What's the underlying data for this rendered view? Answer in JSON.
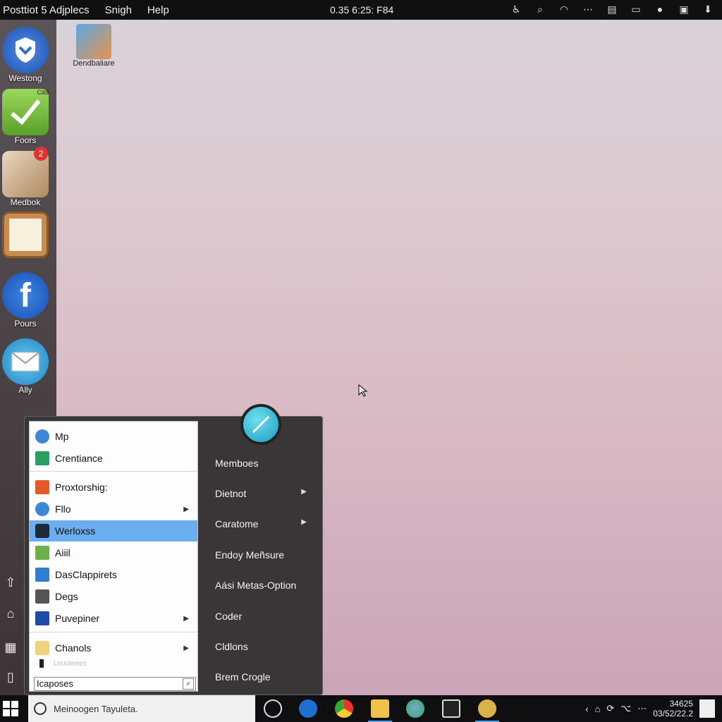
{
  "topbar": {
    "menus": [
      "Posttiot 5 Adjplecs",
      "Snigh",
      "Help"
    ],
    "clock": "0.35 6:25: F84"
  },
  "dock": {
    "apps": [
      {
        "label": "Westong",
        "icon": "shield-icon",
        "color": "#2f6fd0"
      },
      {
        "label": "Foors",
        "icon": "checkmark-icon",
        "color": "#7ac13b",
        "corner": "Cildi"
      },
      {
        "label": "Medbok",
        "icon": "photo-icon",
        "color": "#caa98a",
        "badge": "2"
      },
      {
        "label": "",
        "icon": "notepad-icon",
        "color": "#c9894a"
      },
      {
        "label": "Pours",
        "icon": "facebook-icon",
        "color": "#2a6ed4"
      },
      {
        "label": "Ally",
        "icon": "mail-icon",
        "color": "#3aa7e0"
      }
    ]
  },
  "desktop_icon": {
    "label": "Dendbaliare"
  },
  "start_menu": {
    "left_items": [
      {
        "label": "Mp",
        "color": "#3b87d8"
      },
      {
        "label": "Crentiance",
        "color": "#2aa060"
      },
      {
        "label": "Proxtorshig:",
        "color": "#e35b2b"
      },
      {
        "label": "Fllo",
        "color": "#3a89d2",
        "arrow": true
      },
      {
        "label": "Werloxss",
        "color": "#1e2a3a",
        "selected": true
      },
      {
        "label": "Aiiil",
        "color": "#6bb04a"
      },
      {
        "label": "DasClappirets",
        "color": "#2e7fcf"
      },
      {
        "label": "Degs",
        "color": "#555555"
      },
      {
        "label": "Puvepiner",
        "color": "#1f4aa8",
        "arrow": true
      },
      {
        "label": "Chanols",
        "color": "#f0d37a",
        "arrow": true
      }
    ],
    "faded_item": "Lnuuteees",
    "search_value": "Icaposes",
    "right_items": [
      {
        "label": "Memboes"
      },
      {
        "label": "Dietnot",
        "arrow": true
      },
      {
        "label": "Caratome",
        "arrow": true
      },
      {
        "label": "Endoy Meñsure"
      },
      {
        "label": "Aási Metas-Option"
      },
      {
        "label": "Coder"
      },
      {
        "label": "Cldlons"
      },
      {
        "label": "Brem Crogle"
      }
    ]
  },
  "taskbar": {
    "search_placeholder": "Meinoogen Tayuleta.",
    "clock_time": "34625",
    "clock_date": "03/52/22.2"
  }
}
